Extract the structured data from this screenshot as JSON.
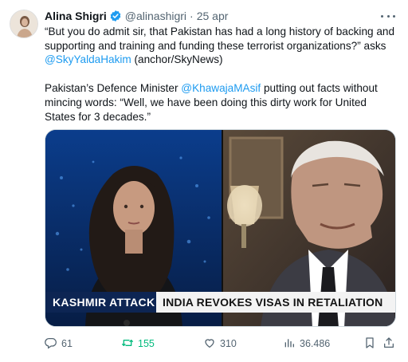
{
  "tweet": {
    "author_name": "Alina Shigri",
    "handle": "@alinashigri",
    "separator": "·",
    "date": "25 apr",
    "quote_text": "“But you do admit sir, that Pakistan has had a long history of backing and supporting and training and funding these terrorist organizations?” asks ",
    "mention1": "@SkyYaldaHakim",
    "after_mention1": " (anchor/SkyNews)",
    "para2_start": "Pakistan’s Defence Minister ",
    "mention2": "@KhawajaMAsif",
    "para2_end": " putting out facts without mincing words: “Well, we have been doing this dirty work for United States for 3 decades.”"
  },
  "media": {
    "caption_left": "KASHMIR ATTACK",
    "caption_right": "INDIA REVOKES VISAS IN RETALIATION",
    "caption_left_bg": "#0d2553",
    "caption_right_bg": "#f3f3f3"
  },
  "actions": {
    "replies": "61",
    "reposts": "155",
    "likes": "310",
    "views": "36.486",
    "repost_color": "#00ba7c",
    "icon_color": "#536471"
  },
  "icons": [
    "verified-badge-icon",
    "more-options-icon",
    "reply-icon",
    "repost-icon",
    "like-icon",
    "views-icon",
    "bookmark-icon",
    "share-icon"
  ]
}
